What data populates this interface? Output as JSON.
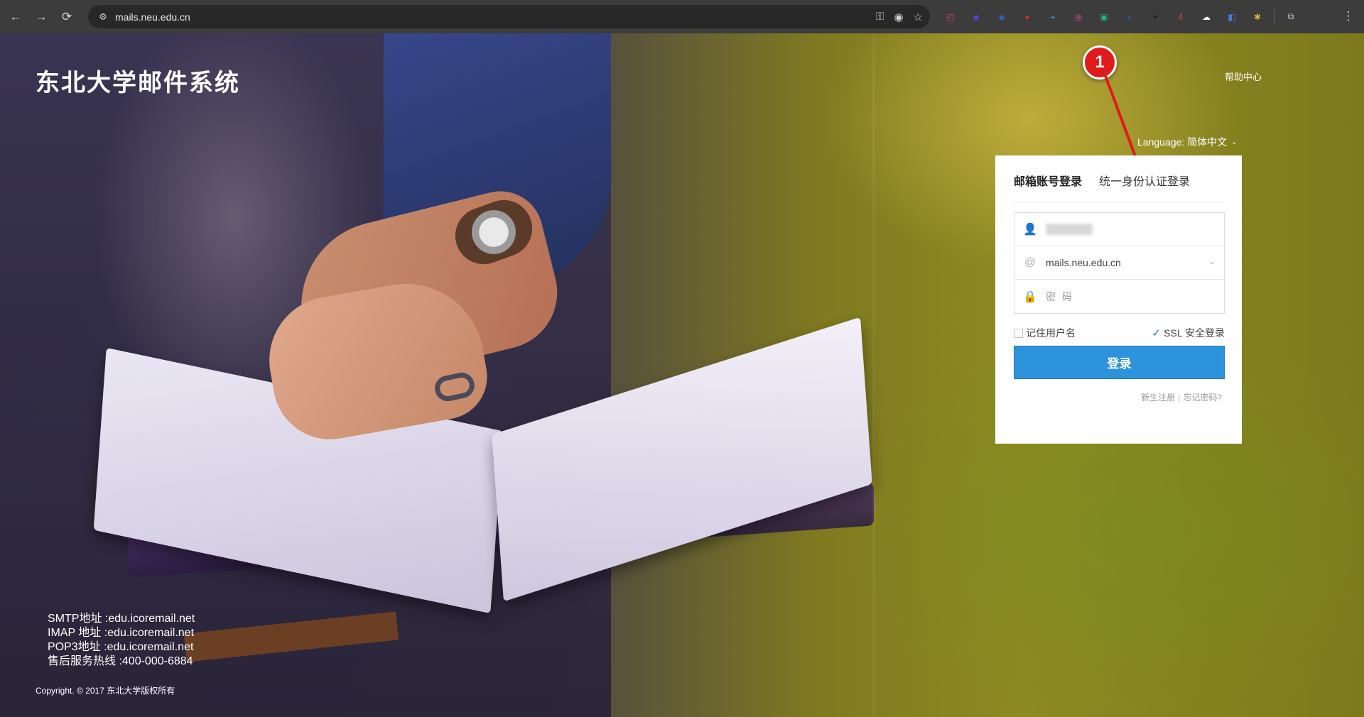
{
  "browser": {
    "url": "mails.neu.edu.cn",
    "nav": {
      "back": "←",
      "forward": "→",
      "reload": "⟳"
    },
    "omni_icons": [
      "key-icon",
      "eye-icon",
      "star-icon"
    ],
    "extensions": [
      {
        "name": "ext-1",
        "color": "#d6457a",
        "glyph": "◰"
      },
      {
        "name": "ext-2",
        "color": "#5b3bd8",
        "glyph": "◆"
      },
      {
        "name": "ext-3",
        "color": "#2f6bd6",
        "glyph": "◈"
      },
      {
        "name": "ext-4",
        "color": "#d62828",
        "glyph": "●"
      },
      {
        "name": "ext-5",
        "color": "#4aa3df",
        "glyph": "⌁"
      },
      {
        "name": "ext-6",
        "color": "#e84f9b",
        "glyph": "◎"
      },
      {
        "name": "ext-7",
        "color": "#25b48a",
        "glyph": "▣"
      },
      {
        "name": "ext-8",
        "color": "#2b5fd0",
        "glyph": "◗"
      },
      {
        "name": "ext-9",
        "color": "#222222",
        "glyph": "✦"
      },
      {
        "name": "ext-10",
        "color": "#e03b3b",
        "glyph": "4"
      },
      {
        "name": "ext-11",
        "color": "#f0f0f0",
        "glyph": "☁"
      },
      {
        "name": "ext-12",
        "color": "#3f7de0",
        "glyph": "◧"
      },
      {
        "name": "ext-13",
        "color": "#e0b52e",
        "glyph": "✱"
      },
      {
        "name": "ext-14",
        "color": "#cfcfcf",
        "glyph": "⧉"
      }
    ],
    "menu": "⋮"
  },
  "header": {
    "site_title": "东北大学邮件系统",
    "help": "帮助中心",
    "language": "Language: 简体中文",
    "annotation_number": "1"
  },
  "login": {
    "tabs": [
      {
        "label": "邮箱账号登录",
        "active": true
      },
      {
        "label": "统一身份认证登录",
        "active": false
      }
    ],
    "domain": "mails.neu.edu.cn",
    "password_placeholder": "密码",
    "remember": "记住用户名",
    "ssl": "SSL 安全登录",
    "ssl_checked": true,
    "submit": "登录",
    "register": "新生注册",
    "forgot": "忘记密码?"
  },
  "footer": {
    "lines": [
      "SMTP地址 :edu.icoremail.net",
      "IMAP 地址 :edu.icoremail.net",
      "POP3地址 :edu.icoremail.net",
      "售后服务热线 :400-000-6884"
    ],
    "copyright": "Copyright. © 2017 东北大学版权所有"
  },
  "colors": {
    "login_button": "#2e93dd",
    "annotation": "#e01b1b"
  }
}
